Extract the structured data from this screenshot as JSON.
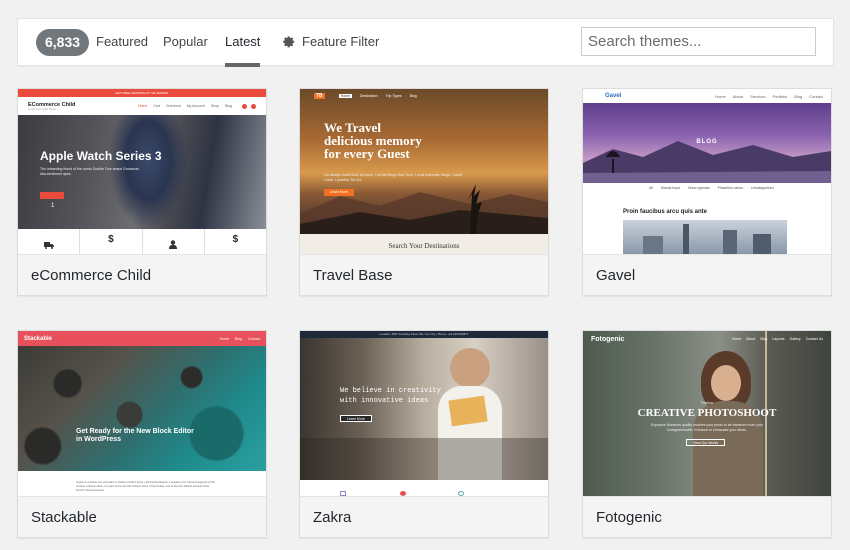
{
  "filter": {
    "count": "6,833",
    "tabs": [
      "Featured",
      "Popular",
      "Latest"
    ],
    "active_tab": "Latest",
    "feature_filter": "Feature Filter",
    "search_placeholder": "Search themes..."
  },
  "themes": [
    {
      "name": "eCommerce Child",
      "preview": {
        "topbar": "GET FREE SHIPPING IN THE BASKET",
        "logo": "ECommerce Child",
        "tagline": "eCommerce Child Theme",
        "nav": [
          "Home",
          "Cart",
          "Checkout",
          "My Account",
          "Shop",
          "Blog"
        ],
        "hero": "Apple Watch Series 3",
        "hero_sub": "Tho intraeding friend of the comic Double Tour wraps Grossman Alia sentiment apes.",
        "page": "1",
        "icons": [
          "truck-icon",
          "dollar-icon",
          "user-icon",
          "dollar-icon"
        ]
      }
    },
    {
      "name": "Travel Base",
      "preview": {
        "logo": "TB",
        "nav": [
          "Home",
          "Destination",
          "Trip Types",
          "Blog"
        ],
        "hero": [
          "We Travel",
          "delicious memory",
          "for every Guest"
        ],
        "hero_sub": "I've always loved food. At home, I do the things that I love. I cook elaborate things. I paint. I write. I practice Tai Chi.",
        "button": "Learn More",
        "footer": "Search Your Destinations"
      }
    },
    {
      "name": "Gavel",
      "preview": {
        "logo": "Gavel",
        "nav": [
          "Home",
          "About",
          "Services",
          "Portfolio",
          "Blog",
          "Contact"
        ],
        "banner": "BLOG",
        "tabs": [
          "All",
          "Mauris turps",
          "Nunc egestas",
          "Phasellus varius",
          "Uncategorized"
        ],
        "post_title": "Proin faucibus arcu quis ante"
      }
    },
    {
      "name": "Stackable",
      "preview": {
        "logo": "Stackable",
        "nav": [
          "Home",
          "Blog",
          "Contact"
        ],
        "hero": [
          "Get Ready for the New Block Editor",
          "in WordPress"
        ],
        "body": "Tupiya is a tribute ocu volunaire in northern Chile's Arica y Parinacota Region, Located in the Clorned segment of the Andean volcanic chain. It is part of the Central Volcanic Zone of the Andes, one of the four distinct volcanic belts found in South America."
      }
    },
    {
      "name": "Zakra",
      "preview": {
        "topbar": "Location: 4567 Kentucky Street 3R, Your City | Phone: +01 4376329877",
        "hero": [
          "We believe in creativity",
          "with innovative ideas"
        ],
        "button": "Learn More"
      }
    },
    {
      "name": "Fotogenic",
      "preview": {
        "logo": "Fotogenic",
        "nav": [
          "Home",
          "About",
          "Blog",
          "Layouts",
          "Gallery",
          "Contact Us"
        ],
        "kicker": "Fashion",
        "hero": "CREATIVE PHOTOSHOOT",
        "hero_sub": "Exposure Moments quality enables your photo to be transform from your Instagrammable. Enhance to showcase your ideas.",
        "button": "View Our Works"
      }
    }
  ],
  "colors": {
    "count_badge": "#72777c",
    "active_underline": "#666666",
    "stackable_red": "#e8505b",
    "travel_orange": "#f37021"
  }
}
